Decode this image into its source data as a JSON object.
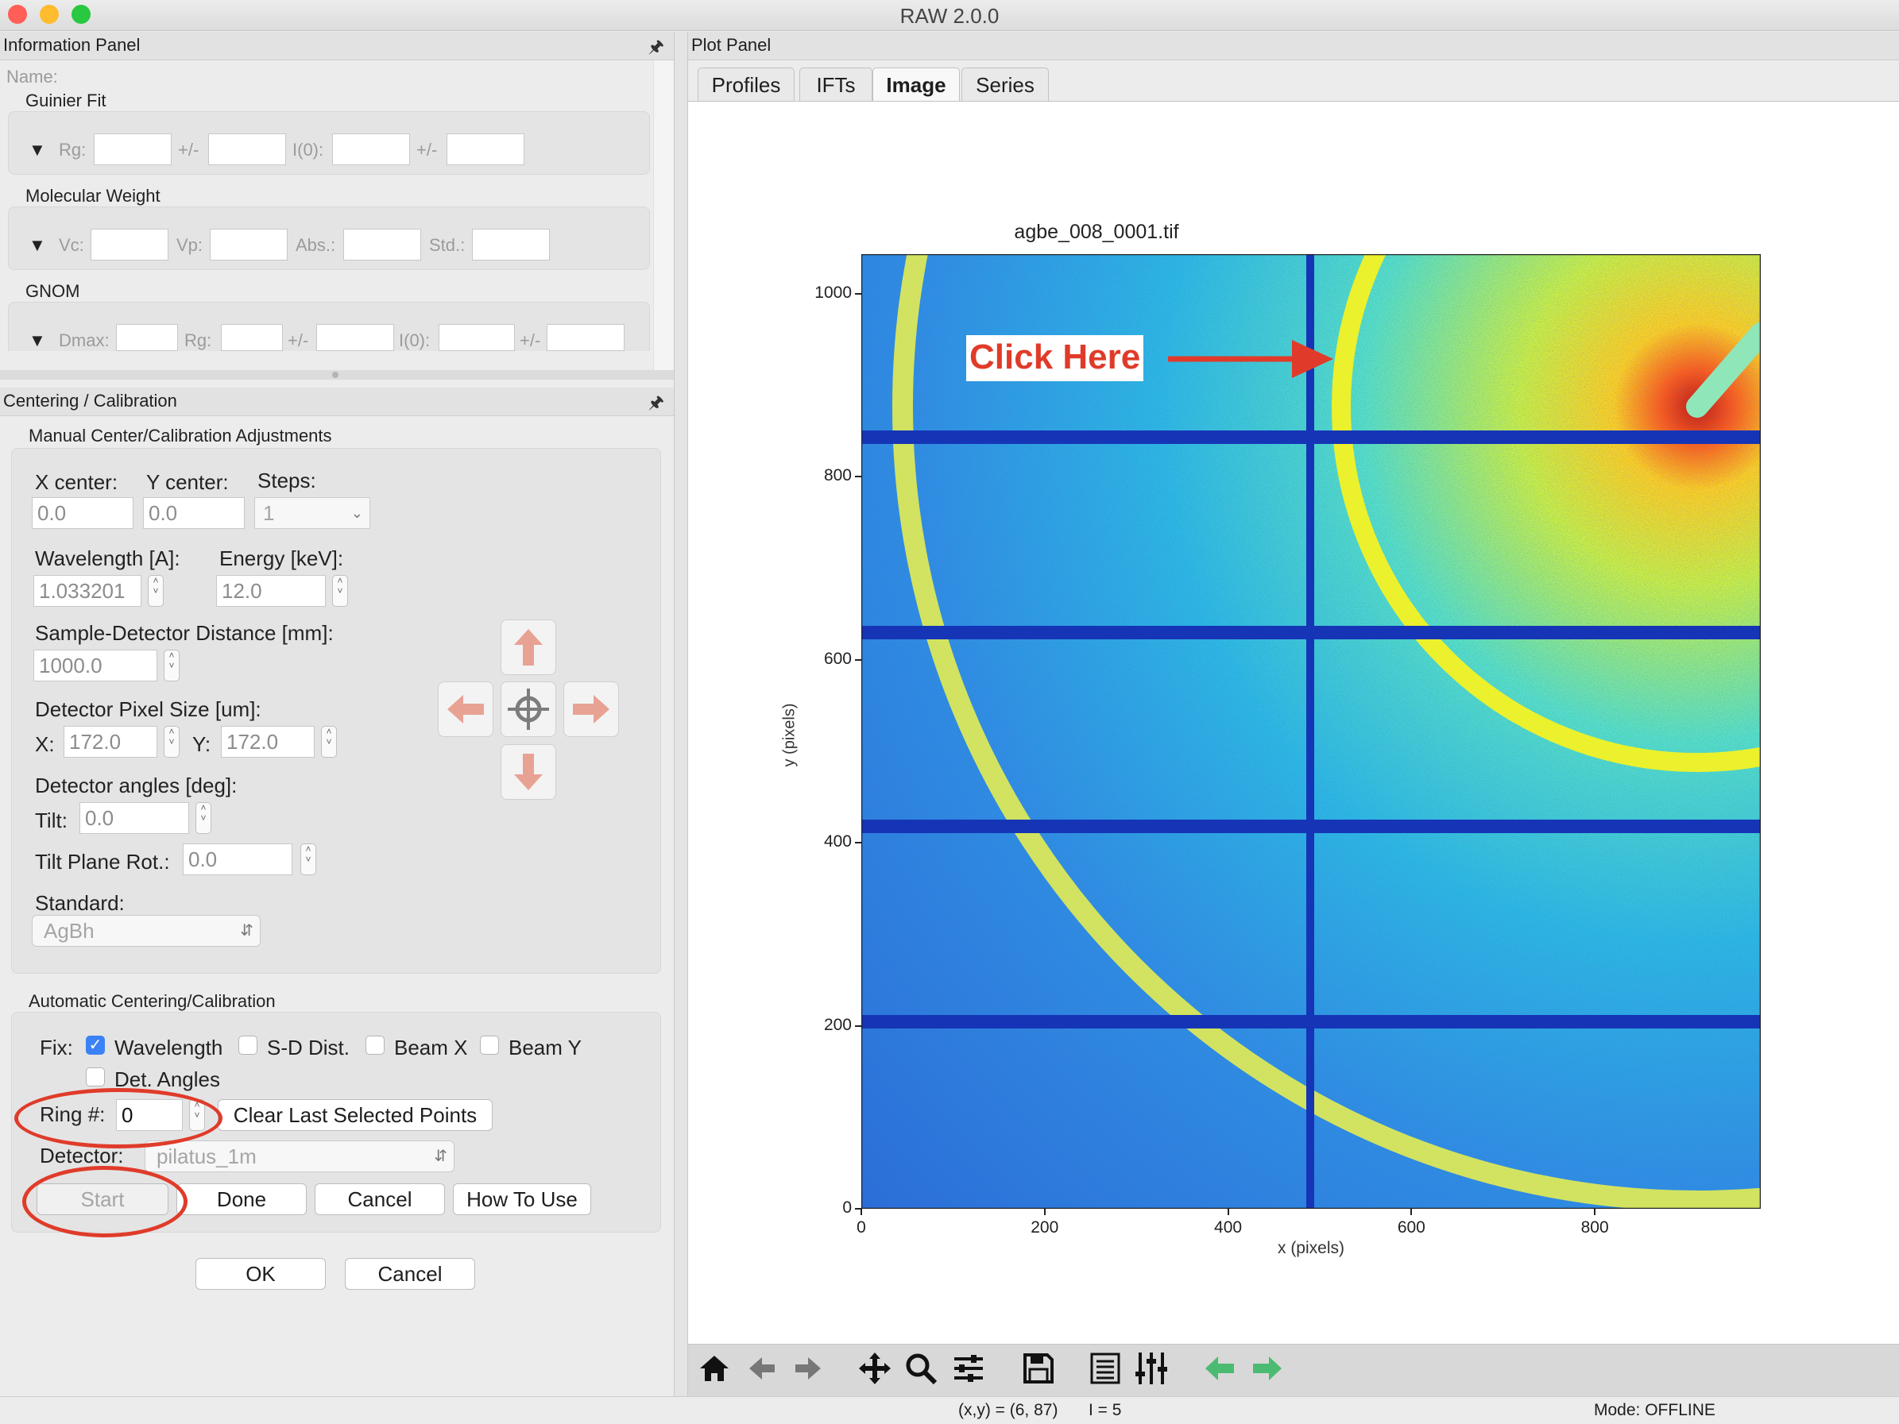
{
  "window": {
    "title": "RAW 2.0.0"
  },
  "info_panel": {
    "title": "Information Panel",
    "name_label": "Name:",
    "guinier": {
      "title": "Guinier Fit",
      "rg": "Rg:",
      "pm1": "+/-",
      "i0": "I(0):",
      "pm2": "+/-"
    },
    "mw": {
      "title": "Molecular Weight",
      "vc": "Vc:",
      "vp": "Vp:",
      "abs": "Abs.:",
      "std": "Std.:"
    },
    "gnom": {
      "title": "GNOM",
      "dmax": "Dmax:",
      "rg": "Rg:",
      "pm1": "+/-",
      "i0": "I(0):",
      "pm2": "+/-"
    }
  },
  "centering": {
    "title": "Centering / Calibration",
    "manual_title": "Manual Center/Calibration Adjustments",
    "x_center_label": "X center:",
    "x_center": "0.0",
    "y_center_label": "Y center:",
    "y_center": "0.0",
    "steps_label": "Steps:",
    "steps": "1",
    "wavelength_label": "Wavelength [A]:",
    "wavelength": "1.033201",
    "energy_label": "Energy [keV]:",
    "energy": "12.0",
    "sd_label": "Sample-Detector Distance [mm]:",
    "sd": "1000.0",
    "pixel_size_label": "Detector Pixel Size [um]:",
    "px_x_label": "X:",
    "px_x": "172.0",
    "px_y_label": "Y:",
    "px_y": "172.0",
    "angles_label": "Detector angles [deg]:",
    "tilt_label": "Tilt:",
    "tilt": "0.0",
    "tilt_rot_label": "Tilt Plane Rot.:",
    "tilt_rot": "0.0",
    "standard_label": "Standard:",
    "standard": "AgBh",
    "auto_title": "Automatic Centering/Calibration",
    "fix_label": "Fix:",
    "fix_wavelength": "Wavelength",
    "fix_sd": "S-D Dist.",
    "fix_beamx": "Beam X",
    "fix_beamy": "Beam Y",
    "fix_angles": "Det. Angles",
    "ring_label": "Ring #:",
    "ring": "0",
    "clear_points": "Clear Last Selected Points",
    "detector_label": "Detector:",
    "detector": "pilatus_1m",
    "start": "Start",
    "done": "Done",
    "cancel": "Cancel",
    "how_to": "How To Use",
    "ok": "OK",
    "cancel2": "Cancel"
  },
  "plot_panel": {
    "title": "Plot Panel",
    "tabs": [
      "Profiles",
      "IFTs",
      "Image",
      "Series"
    ],
    "active_tab": "Image"
  },
  "chart_data": {
    "type": "heatmap",
    "title": "agbe_008_0001.tif",
    "xlabel": "x (pixels)",
    "ylabel": "y (pixels)",
    "xlim": [
      0,
      981
    ],
    "ylim": [
      0,
      1043
    ],
    "x_ticks": [
      "0",
      "200",
      "400",
      "600",
      "800"
    ],
    "y_ticks": [
      "0",
      "200",
      "400",
      "600",
      "800",
      "1000"
    ],
    "annotation": "Click Here"
  },
  "status_bar": {
    "coords": "(x,y) = (6, 87)",
    "intensity": "I = 5",
    "mode": "Mode: OFFLINE"
  },
  "colors": {
    "annotation": "#e03b2a",
    "checkbox": "#3b82f6",
    "nav_arrow": "#e8a293",
    "green_arrow": "#4cbb72"
  }
}
